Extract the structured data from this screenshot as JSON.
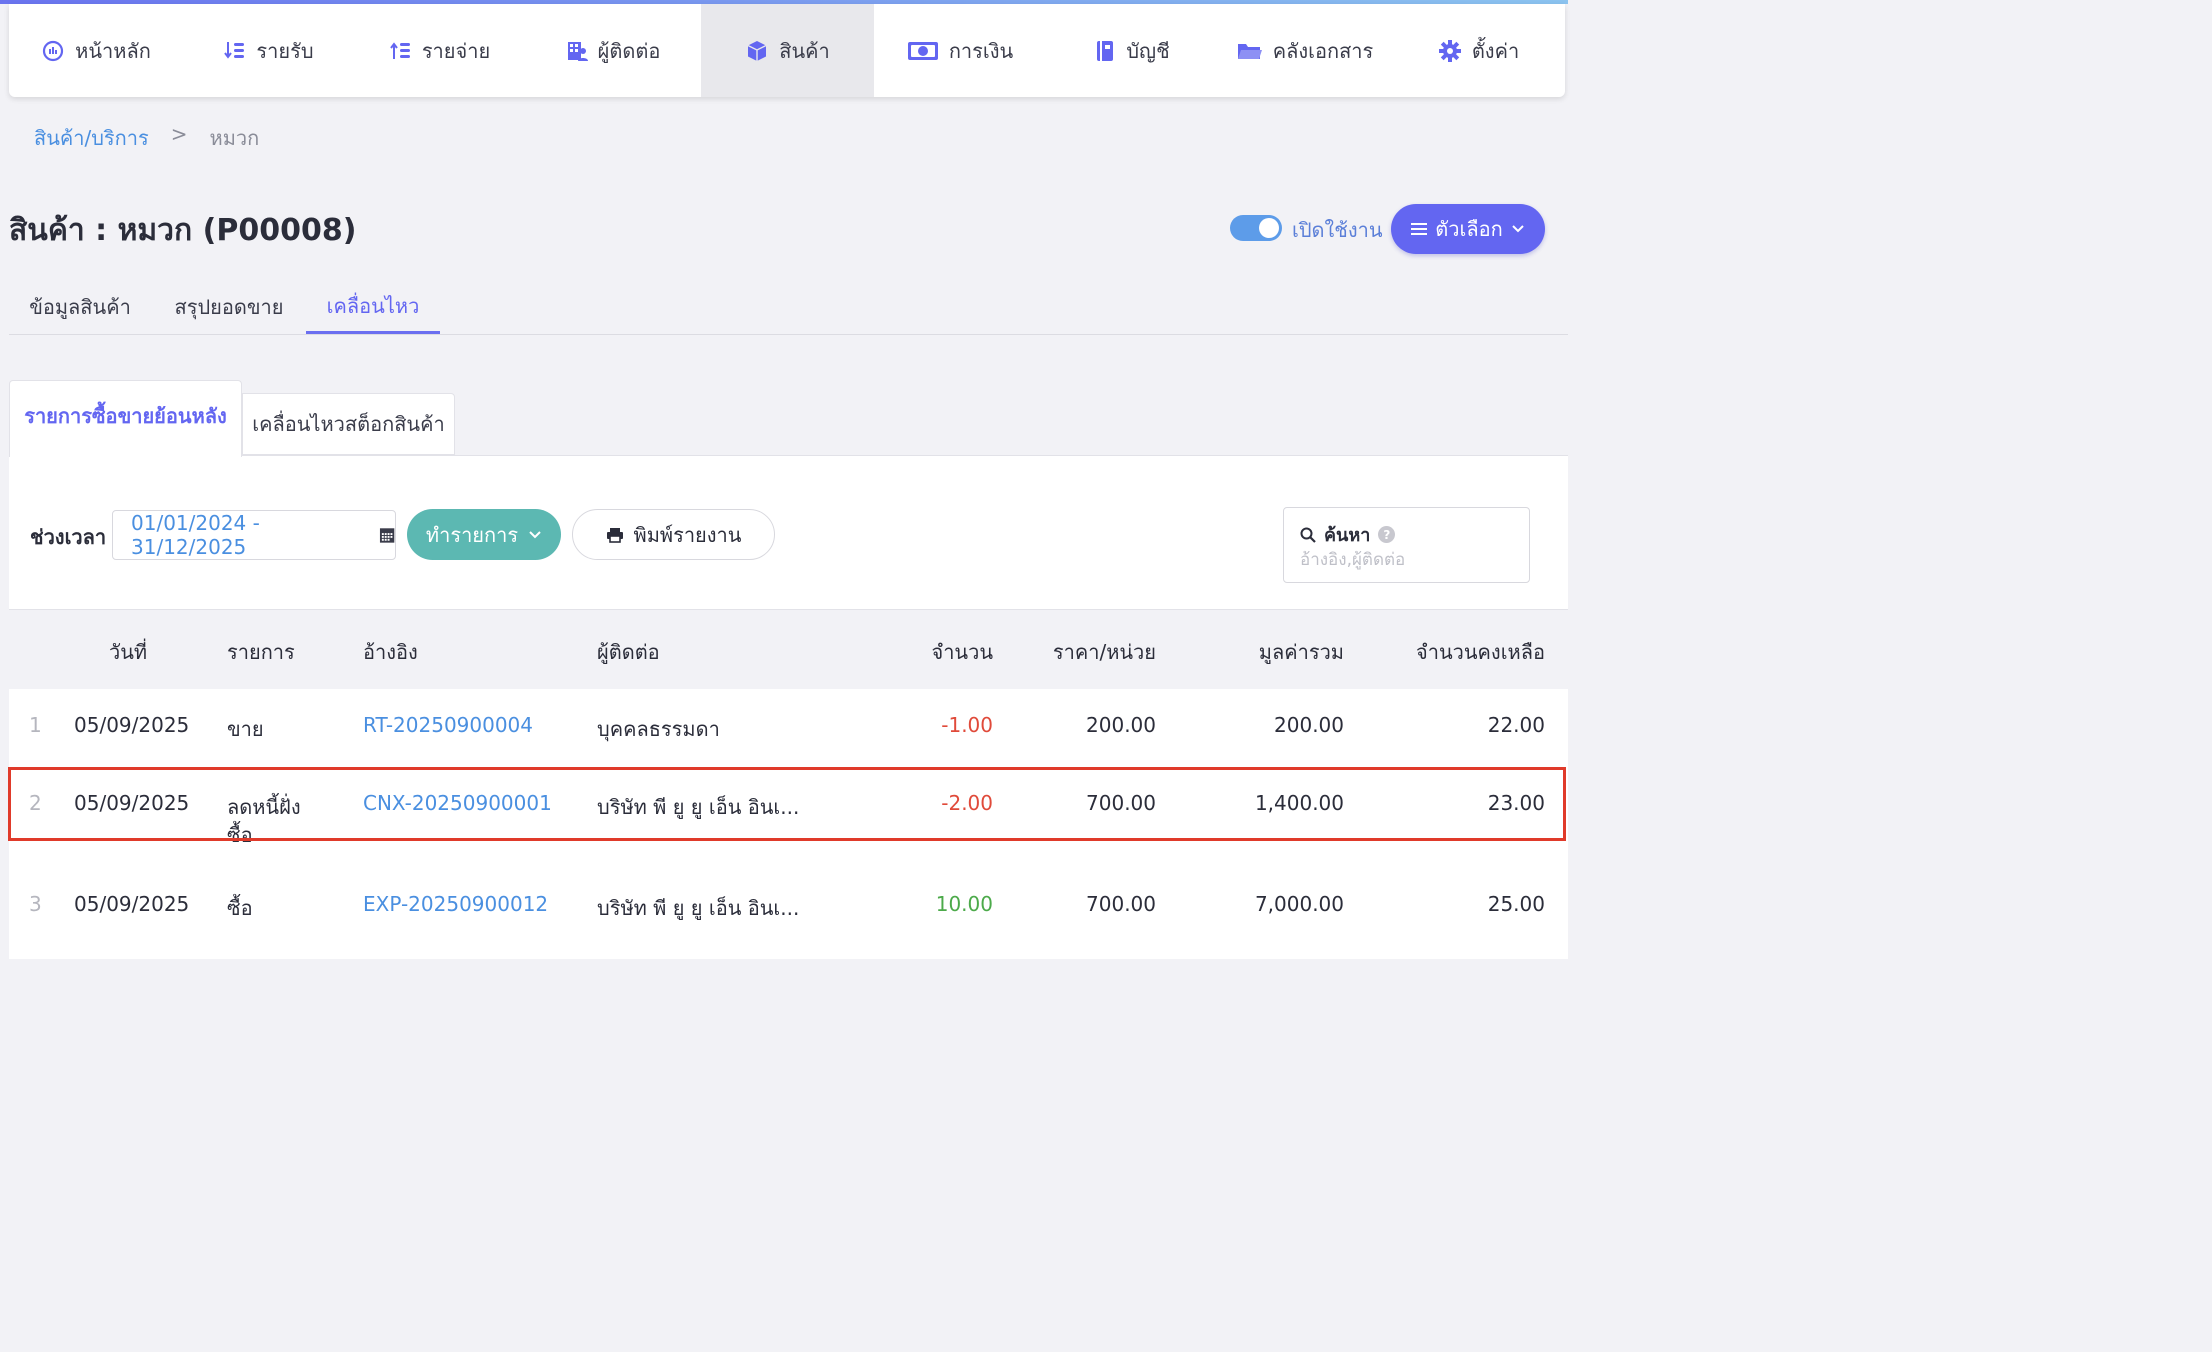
{
  "nav": {
    "items": [
      {
        "label": "หน้าหลัก",
        "icon": "dashboard-icon"
      },
      {
        "label": "รายรับ",
        "icon": "income-icon"
      },
      {
        "label": "รายจ่าย",
        "icon": "expense-icon"
      },
      {
        "label": "ผู้ติดต่อ",
        "icon": "contacts-icon"
      },
      {
        "label": "สินค้า",
        "icon": "box-icon"
      },
      {
        "label": "การเงิน",
        "icon": "money-icon"
      },
      {
        "label": "บัญชี",
        "icon": "ledger-icon"
      },
      {
        "label": "คลังเอกสาร",
        "icon": "folder-icon"
      },
      {
        "label": "ตั้งค่า",
        "icon": "gear-icon"
      }
    ],
    "active_index": 4
  },
  "breadcrumb": {
    "parent": "สินค้า/บริการ",
    "separator": ">",
    "current": "หมวก"
  },
  "page": {
    "title": "สินค้า : หมวก (P00008)",
    "toggle_label": "เปิดใช้งาน",
    "toggle_on": true,
    "options_label": "ตัวเลือก"
  },
  "tabs": {
    "info": "ข้อมูลสินค้า",
    "sales_summary": "สรุปยอดขาย",
    "movement": "เคลื่อนไหว"
  },
  "subtabs": {
    "history": "รายการซื้อขายย้อนหลัง",
    "stock": "เคลื่อนไหวสต็อกสินค้า"
  },
  "filters": {
    "period_label": "ช่วงเวลา",
    "date_range": "01/01/2024 - 31/12/2025",
    "action_label": "ทำรายการ",
    "print_label": "พิมพ์รายงาน",
    "search_label": "ค้นหา",
    "search_placeholder": "อ้างอิง,ผู้ติดต่อ"
  },
  "table": {
    "headers": {
      "date": "วันที่",
      "type": "รายการ",
      "ref": "อ้างอิง",
      "contact": "ผู้ติดต่อ",
      "qty": "จำนวน",
      "unit_price": "ราคา/หน่วย",
      "total": "มูลค่ารวม",
      "balance": "จำนวนคงเหลือ"
    },
    "rows": [
      {
        "no": "1",
        "date": "05/09/2025",
        "type": "ขาย",
        "type2": "",
        "ref": "RT-20250900004",
        "contact": "บุคคลธรรมดา",
        "qty": "-1.00",
        "unit_price": "200.00",
        "total": "200.00",
        "balance": "22.00"
      },
      {
        "no": "2",
        "date": "05/09/2025",
        "type": "ลดหนี้ฝั่ง",
        "type2": "ซื้อ",
        "ref": "CNX-20250900001",
        "contact": "บริษัท พี ยู ยู เอ็น อินเ...",
        "qty": "-2.00",
        "unit_price": "700.00",
        "total": "1,400.00",
        "balance": "23.00"
      },
      {
        "no": "3",
        "date": "05/09/2025",
        "type": "ซื้อ",
        "type2": "",
        "ref": "EXP-20250900012",
        "contact": "บริษัท พี ยู ยู เอ็น อินเ...",
        "qty": "10.00",
        "unit_price": "700.00",
        "total": "7,000.00",
        "balance": "25.00"
      }
    ],
    "highlighted_row": 2
  },
  "colors": {
    "accent": "#6366f1",
    "link": "#4a8fe0",
    "teal": "#5cb8b2",
    "negative": "#e04a3a",
    "positive": "#4caa4a",
    "highlight": "#e03a2a"
  }
}
